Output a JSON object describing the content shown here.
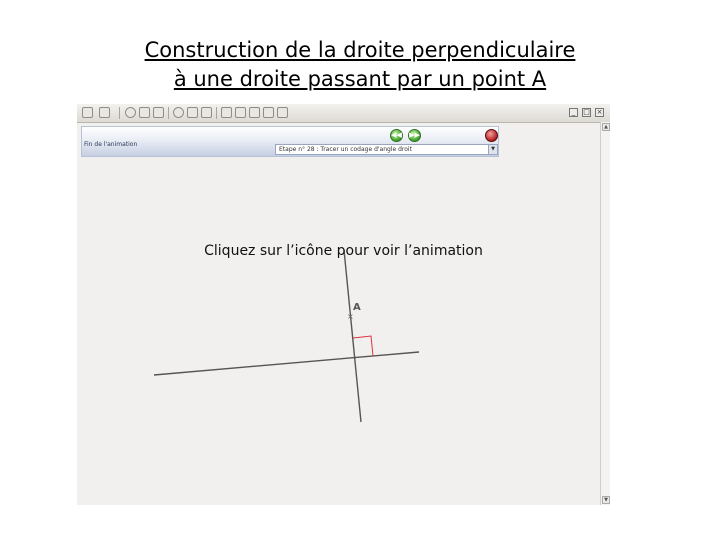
{
  "slide": {
    "title_line1": "Construction de la droite perpendiculaire",
    "title_line2": "à une droite passant par un point A",
    "instruction": "Cliquez sur l’icône pour voir l’animation"
  },
  "player": {
    "panel_label": "Fin de l'animation",
    "step_select_value": "Etape n° 28 : Tracer un codage d'angle droit",
    "select_arrow": "▼",
    "prev_button": "◀◀",
    "next_button": "▶▶",
    "scroll_up": "▲",
    "scroll_down": "▼",
    "window_controls": [
      "_",
      "□",
      "×"
    ]
  },
  "figure": {
    "point_label": "A",
    "point_marker": "×",
    "right_angle_color": "#e0303a",
    "line_color": "#555555"
  }
}
